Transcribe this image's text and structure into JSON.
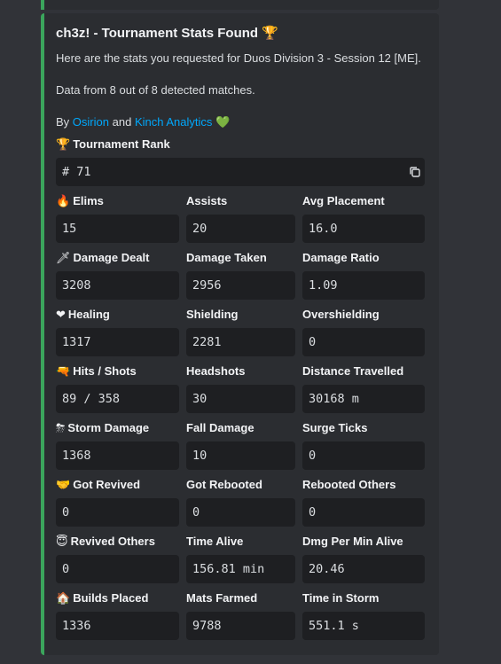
{
  "embed": {
    "title": "ch3z! - Tournament Stats Found",
    "title_emoji": "🏆",
    "description": "Here are the stats you requested for Duos Division 3 - Session 12 [ME].",
    "data_source": "Data from 8 out of 8 detected matches.",
    "credit_prefix": "By",
    "credit_link1": "Osirion",
    "credit_and": "and",
    "credit_link2": "Kinch Analytics",
    "credit_emoji": "💚",
    "accent_color": "#3ba55c",
    "link_color": "#00a8fc"
  },
  "rank": {
    "label": "Tournament Rank",
    "emoji": "🏆",
    "value": "# 71"
  },
  "fields": [
    {
      "label": "Elims",
      "emoji": "🔥",
      "value": "15"
    },
    {
      "label": "Assists",
      "value": "20"
    },
    {
      "label": "Avg Placement",
      "value": "16.0"
    },
    {
      "label": "Damage Dealt",
      "emoji": "🗡",
      "value": "3208"
    },
    {
      "label": "Damage Taken",
      "value": "2956"
    },
    {
      "label": "Damage Ratio",
      "value": "1.09"
    },
    {
      "label": "Healing",
      "emoji": "❤",
      "value": "1317"
    },
    {
      "label": "Shielding",
      "value": "2281"
    },
    {
      "label": "Overshielding",
      "value": "0"
    },
    {
      "label": "Hits / Shots",
      "emoji": "🔫",
      "value": "89 / 358"
    },
    {
      "label": "Headshots",
      "value": "30"
    },
    {
      "label": "Distance Travelled",
      "value": "30168 m"
    },
    {
      "label": "Storm Damage",
      "emoji": "⛈",
      "value": "1368"
    },
    {
      "label": "Fall Damage",
      "value": "10"
    },
    {
      "label": "Surge Ticks",
      "value": "0"
    },
    {
      "label": "Got Revived",
      "emoji": "🤝",
      "value": "0"
    },
    {
      "label": "Got Rebooted",
      "value": "0"
    },
    {
      "label": "Rebooted Others",
      "value": "0"
    },
    {
      "label": "Revived Others",
      "emoji": "😇",
      "value": "0"
    },
    {
      "label": "Time Alive",
      "value": "156.81 min"
    },
    {
      "label": "Dmg Per Min Alive",
      "value": "20.46"
    },
    {
      "label": "Builds Placed",
      "emoji": "🏠",
      "value": "1336"
    },
    {
      "label": "Mats Farmed",
      "value": "9788"
    },
    {
      "label": "Time in Storm",
      "value": "551.1 s"
    }
  ],
  "icons": {
    "copy": "copy-icon"
  }
}
